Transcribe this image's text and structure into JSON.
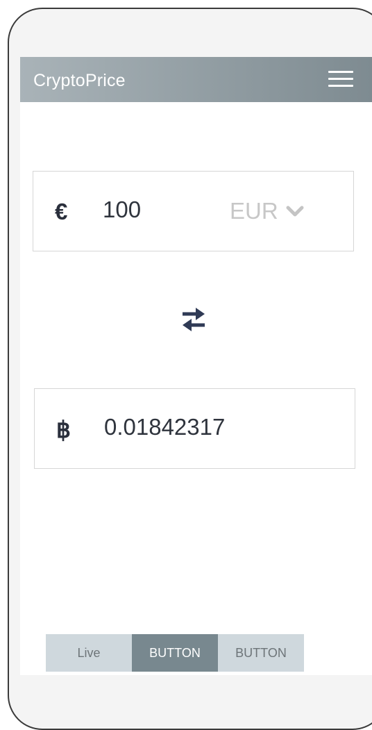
{
  "app_bar": {
    "title": "CryptoPrice",
    "menu_icon": "hamburger-menu-icon"
  },
  "converter": {
    "from": {
      "symbol": "€",
      "amount": "100",
      "currency": "EUR",
      "dropdown_icon": "chevron-down-icon"
    },
    "swap_icon": "swap-arrows-icon",
    "to": {
      "symbol": "฿",
      "amount": "0.01842317"
    }
  },
  "tabs": [
    {
      "label": "Live",
      "active": false
    },
    {
      "label": "BUTTON",
      "active": true
    },
    {
      "label": "BUTTON",
      "active": false
    }
  ],
  "colors": {
    "app_bar_start": "#a9b3b8",
    "app_bar_end": "#7e8b91",
    "tab_inactive": "#cfd8dd",
    "tab_active": "#78888f",
    "icon_dark": "#2f3a55"
  }
}
